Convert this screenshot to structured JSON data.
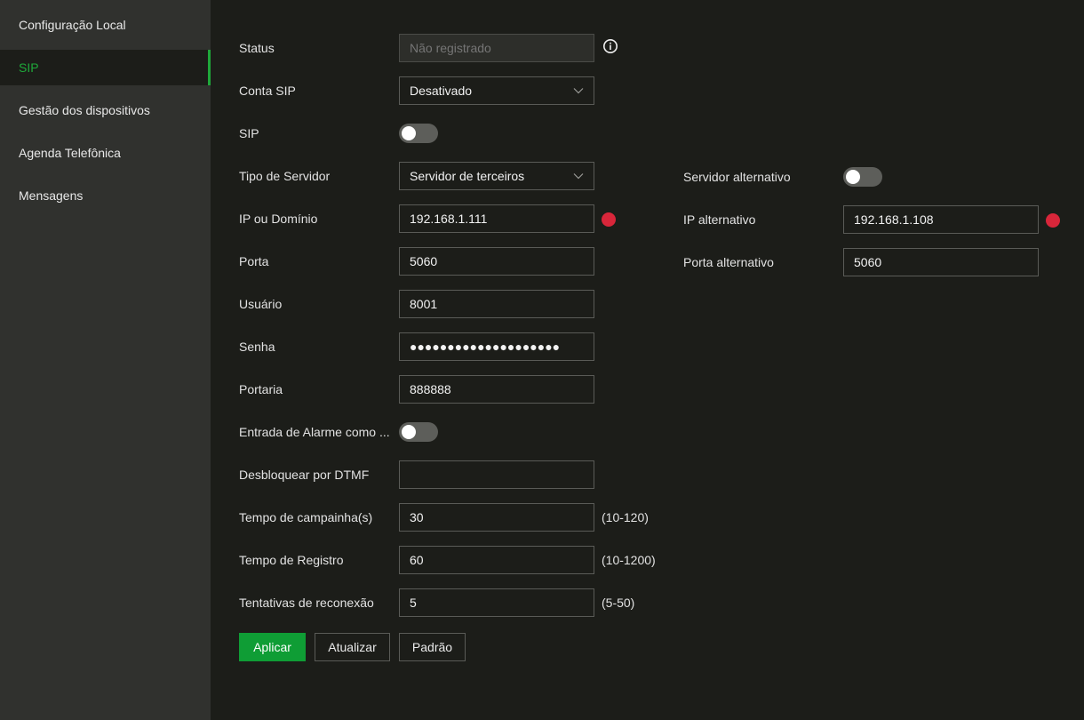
{
  "sidebar": {
    "items": [
      {
        "label": "Configuração Local"
      },
      {
        "label": "SIP"
      },
      {
        "label": "Gestão dos dispositivos"
      },
      {
        "label": "Agenda Telefônica"
      },
      {
        "label": "Mensagens"
      }
    ]
  },
  "form": {
    "status": {
      "label": "Status",
      "placeholder": "Não registrado"
    },
    "sip_account": {
      "label": "Conta SIP",
      "value": "Desativado"
    },
    "sip": {
      "label": "SIP",
      "enabled": false
    },
    "server_type": {
      "label": "Tipo de Servidor",
      "value": "Servidor de terceiros"
    },
    "ip_domain": {
      "label": "IP ou Domínio",
      "value": "192.168.1.111"
    },
    "port": {
      "label": "Porta",
      "value": "5060"
    },
    "user": {
      "label": "Usuário",
      "value": "8001"
    },
    "password": {
      "label": "Senha",
      "value": "●●●●●●●●●●●●●●●●●●●●"
    },
    "gateway": {
      "label": "Portaria",
      "value": "888888"
    },
    "alarm_input": {
      "label": "Entrada de Alarme como ...",
      "enabled": false
    },
    "dtmf_unlock": {
      "label": "Desbloquear por DTMF",
      "value": ""
    },
    "ring_time": {
      "label": "Tempo de campainha(s)",
      "value": "30",
      "range": "(10-120)"
    },
    "register_time": {
      "label": "Tempo de Registro",
      "value": "60",
      "range": "(10-1200)"
    },
    "reconnect_attempts": {
      "label": "Tentativas de reconexão",
      "value": "5",
      "range": "(5-50)"
    }
  },
  "alternate": {
    "server": {
      "label": "Servidor alternativo",
      "enabled": false
    },
    "ip": {
      "label": "IP alternativo",
      "value": "192.168.1.108"
    },
    "port": {
      "label": "Porta alternativo",
      "value": "5060"
    }
  },
  "buttons": {
    "apply": "Aplicar",
    "refresh": "Atualizar",
    "default": "Padrão"
  },
  "colors": {
    "accent": "#1fa83a",
    "primary_button": "#0f9d35",
    "required_dot": "#d8263a",
    "sidebar_bg": "#30312e",
    "main_bg": "#1c1d19"
  }
}
